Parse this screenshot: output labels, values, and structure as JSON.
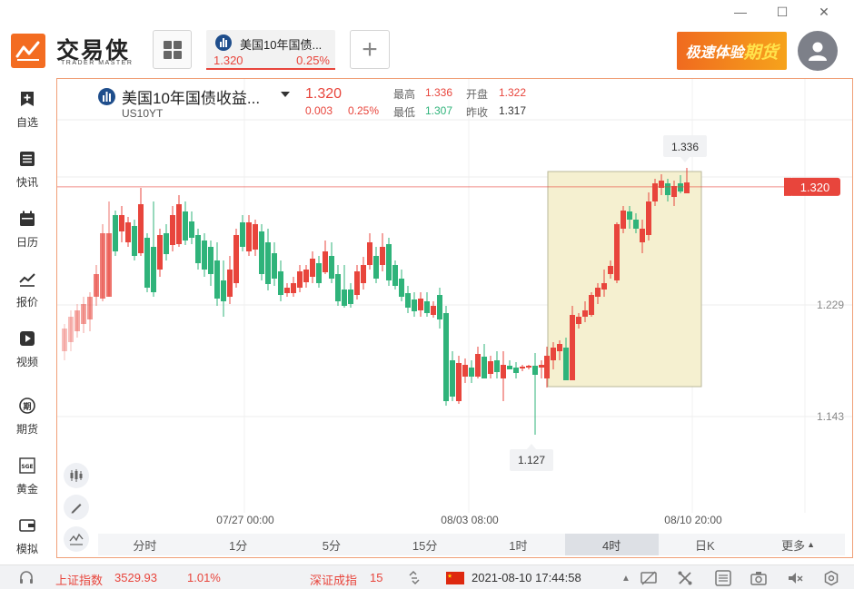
{
  "window": {
    "minimize_glyph": "—",
    "maximize_glyph": "☐",
    "close_glyph": "✕"
  },
  "header": {
    "logo_text": "交易侠",
    "logo_sub": "TRADER MASTER",
    "active_tab": {
      "title": "美国10年国债...",
      "price": "1.320",
      "pct": "0.25%"
    },
    "add_tab_glyph": "+",
    "promo_text_a": "极速体验",
    "promo_text_b": "期货"
  },
  "sidebar": {
    "items": [
      {
        "label": "自选",
        "icon": "bookmark-plus-icon"
      },
      {
        "label": "快讯",
        "icon": "list-icon"
      },
      {
        "label": "日历",
        "icon": "calendar-icon"
      },
      {
        "label": "报价",
        "icon": "trend-line-icon"
      },
      {
        "label": "视频",
        "icon": "play-icon"
      },
      {
        "label": "期货",
        "icon": "futures-icon"
      },
      {
        "label": "黄金",
        "icon": "sge-icon"
      },
      {
        "label": "模拟",
        "icon": "wallet-icon"
      }
    ]
  },
  "quote": {
    "name": "美国10年国债收益...",
    "code": "US10YT",
    "price": "1.320",
    "change": "0.003",
    "change_pct": "0.25%",
    "high_label": "最高",
    "high": "1.336",
    "low_label": "最低",
    "low": "1.307",
    "open_label": "开盘",
    "open": "1.322",
    "prev_label": "昨收",
    "prev": "1.317"
  },
  "chart": {
    "y_ticks": [
      "1.229",
      "1.143"
    ],
    "x_ticks": [
      "07/27 00:00",
      "08/03 08:00",
      "08/10 20:00"
    ],
    "current_price_label": "1.320",
    "max_label": "1.336",
    "min_label": "1.127",
    "colors": {
      "up": "#e8453c",
      "down": "#2fb37a",
      "highlight": "#f5f0d0"
    }
  },
  "chart_data": {
    "type": "candlestick",
    "y_ticks": [
      1.229,
      1.143
    ],
    "current_price": 1.32,
    "high_marker": 1.336,
    "low_marker": 1.127
  },
  "periods": [
    "分时",
    "1分",
    "5分",
    "15分",
    "1时",
    "4时",
    "日K",
    "更多"
  ],
  "active_period": "4时",
  "status": {
    "index1_name": "上证指数",
    "index1_value": "3529.93",
    "index1_pct": "1.01%",
    "index2_name": "深证成指",
    "index2_value": "15",
    "datetime": "2021-08-10 17:44:58"
  }
}
